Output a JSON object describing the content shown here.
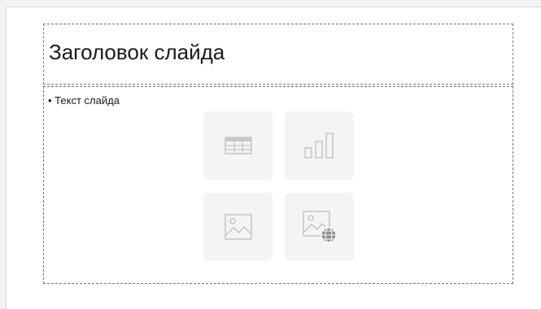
{
  "slide": {
    "title_placeholder": "Заголовок слайда",
    "body_placeholder": "• Текст слайда"
  },
  "insert_icons": [
    {
      "icon": "table-icon"
    },
    {
      "icon": "chart-icon"
    },
    {
      "icon": "image-icon"
    },
    {
      "icon": "online-image-icon"
    }
  ],
  "colors": {
    "placeholder_border": "#777777",
    "icon_stroke": "#b8b8b8",
    "button_bg": "#f4f4f4"
  }
}
